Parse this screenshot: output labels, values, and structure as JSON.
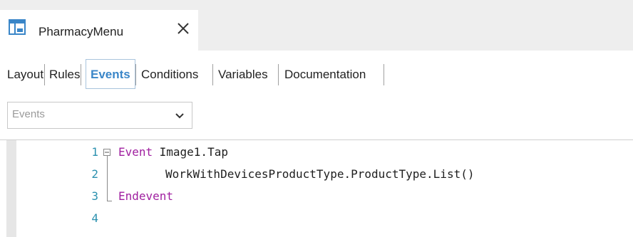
{
  "document_tab": {
    "title": "PharmacyMenu",
    "icon": "panel-layout-icon",
    "close_icon": "close-icon"
  },
  "subtabs": [
    {
      "label": "Layout",
      "active": false
    },
    {
      "label": "Rules",
      "active": false
    },
    {
      "label": "Events",
      "active": true
    },
    {
      "label": "Conditions",
      "active": false
    },
    {
      "label": "Variables",
      "active": false
    },
    {
      "label": "Documentation",
      "active": false
    }
  ],
  "events_combo": {
    "placeholder": "Events",
    "arrow_icon": "chevron-down-icon"
  },
  "editor": {
    "lines": [
      {
        "number": "1",
        "keyword": "Event",
        "text": " Image1.Tap"
      },
      {
        "number": "2",
        "keyword": "",
        "text": "WorkWithDevicesProductType.ProductType.List()"
      },
      {
        "number": "3",
        "keyword": "Endevent",
        "text": ""
      },
      {
        "number": "4",
        "keyword": "",
        "text": ""
      }
    ]
  },
  "colors": {
    "active_tab": "#3a86c8",
    "keyword": "#a020a0",
    "line_number": "#2b91af",
    "tabstrip_bg": "#eeeeee"
  }
}
